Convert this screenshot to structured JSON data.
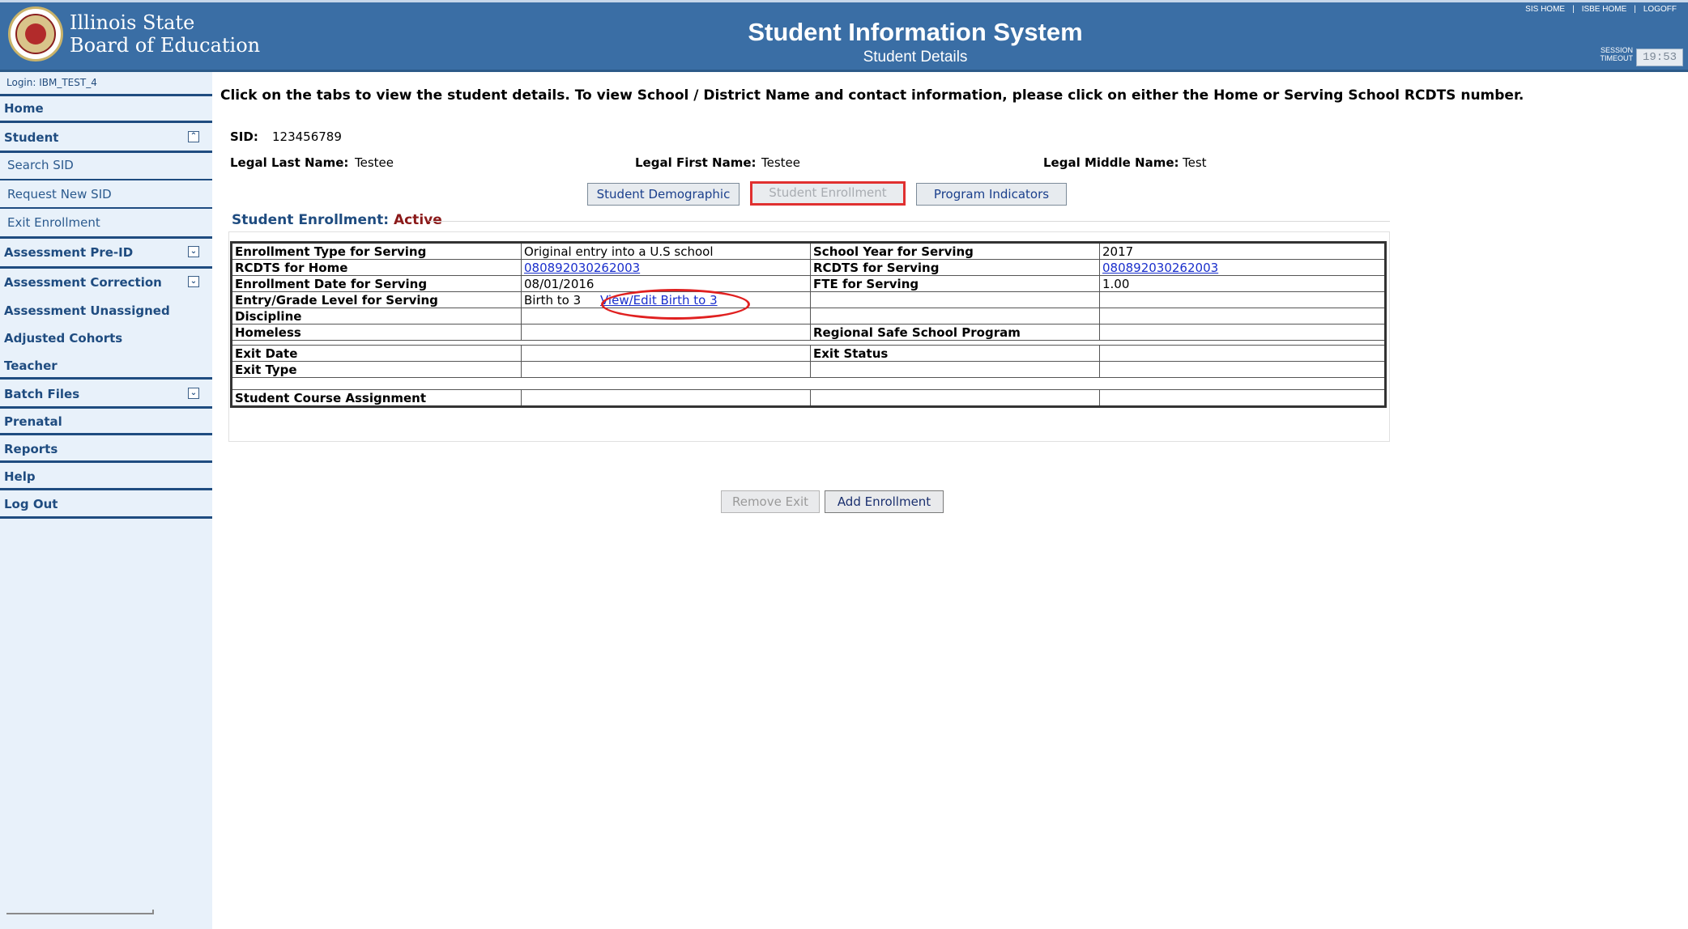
{
  "header": {
    "org_line1": "Illinois State",
    "org_line2": "Board of Education",
    "title": "Student Information System",
    "subtitle": "Student Details",
    "links": [
      "SIS HOME",
      "ISBE HOME",
      "LOGOFF"
    ],
    "session_label1": "SESSION",
    "session_label2": "TIMEOUT",
    "session_time": "19:53"
  },
  "sidebar": {
    "login": "Login: IBM_TEST_4",
    "items": [
      {
        "label": "Home"
      },
      {
        "label": "Student"
      },
      {
        "label": "Search SID"
      },
      {
        "label": "Request New SID"
      },
      {
        "label": "Exit Enrollment"
      },
      {
        "label": "Assessment Pre-ID"
      },
      {
        "label": "Assessment Correction"
      },
      {
        "label": "Assessment Unassigned"
      },
      {
        "label": "Adjusted Cohorts"
      },
      {
        "label": "Teacher"
      },
      {
        "label": "Batch Files"
      },
      {
        "label": "Prenatal"
      },
      {
        "label": "Reports"
      },
      {
        "label": "Help"
      },
      {
        "label": "Log Out"
      }
    ]
  },
  "main": {
    "instruction": "Click on the tabs to view the student details. To view School / District Name and contact information, please click on either the Home or Serving School RCDTS number.",
    "sid_label": "SID:",
    "sid": "123456789",
    "last_name_label": "Legal Last Name:",
    "last_name": "Testee",
    "first_name_label": "Legal First Name:",
    "first_name": "Testee",
    "middle_name_label": "Legal Middle Name:",
    "middle_name": "Test",
    "tabs": [
      {
        "label": "Student Demographic"
      },
      {
        "label": "Student Enrollment"
      },
      {
        "label": "Program Indicators"
      }
    ],
    "section_label": "Student Enrollment:",
    "section_status": "Active",
    "table": {
      "enrollment_type_label": "Enrollment Type for Serving",
      "enrollment_type": "Original entry into a U.S school",
      "school_year_label": "School Year for Serving",
      "school_year": "2017",
      "rcdts_home_label": "RCDTS for Home",
      "rcdts_home": "080892030262003",
      "rcdts_serving_label": "RCDTS for Serving",
      "rcdts_serving": "080892030262003",
      "enroll_date_label": "Enrollment Date for Serving",
      "enroll_date": "08/01/2016",
      "fte_label": "FTE for Serving",
      "fte": "1.00",
      "grade_label": "Entry/Grade Level for Serving",
      "grade": "Birth to 3",
      "birth_link": "View/Edit Birth to 3",
      "discipline_label": "Discipline",
      "homeless_label": "Homeless",
      "regional_label": "Regional Safe School Program",
      "exit_date_label": "Exit Date",
      "exit_status_label": "Exit Status",
      "exit_type_label": "Exit Type",
      "course_label": "Student Course Assignment"
    },
    "remove_exit": "Remove Exit",
    "add_enrollment": "Add Enrollment"
  }
}
